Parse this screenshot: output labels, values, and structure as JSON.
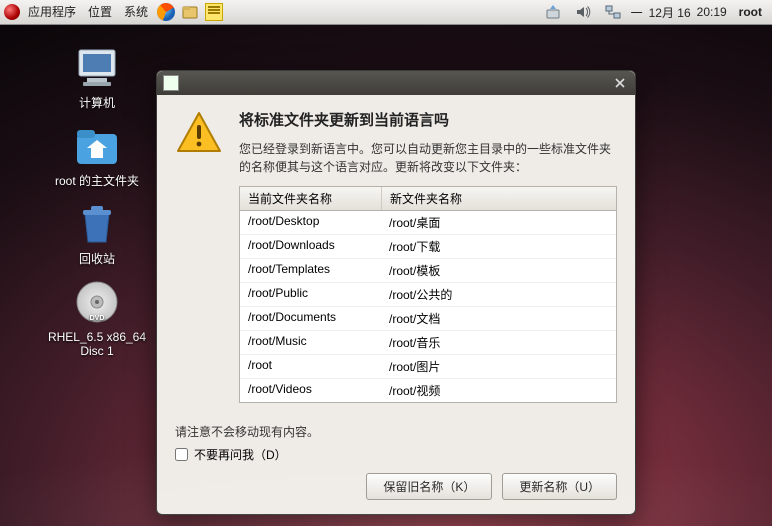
{
  "panel": {
    "menu_apps": "应用程序",
    "menu_places": "位置",
    "menu_system": "系统",
    "clock_day": "一",
    "clock_date": "12月 16",
    "clock_time": "20:19",
    "user": "root"
  },
  "desktop": {
    "computer": "计算机",
    "home": "root 的主文件夹",
    "trash": "回收站",
    "disc": "RHEL_6.5 x86_64 Disc 1"
  },
  "dialog": {
    "heading": "将标准文件夹更新到当前语言吗",
    "message": "您已经登录到新语言中。您可以自动更新您主目录中的一些标准文件夹的名称便其与这个语言对应。更新将改变以下文件夹：",
    "col_old": "当前文件夹名称",
    "col_new": "新文件夹名称",
    "rows": [
      {
        "old": "/root/Desktop",
        "new": "/root/桌面"
      },
      {
        "old": "/root/Downloads",
        "new": "/root/下载"
      },
      {
        "old": "/root/Templates",
        "new": "/root/模板"
      },
      {
        "old": "/root/Public",
        "new": "/root/公共的"
      },
      {
        "old": "/root/Documents",
        "new": "/root/文档"
      },
      {
        "old": "/root/Music",
        "new": "/root/音乐"
      },
      {
        "old": "/root",
        "new": "/root/图片"
      },
      {
        "old": "/root/Videos",
        "new": "/root/视频"
      }
    ],
    "note": "请注意不会移动现有内容。",
    "dont_ask": "不要再问我（D）",
    "btn_keep": "保留旧名称（K）",
    "btn_update": "更新名称（U）"
  }
}
